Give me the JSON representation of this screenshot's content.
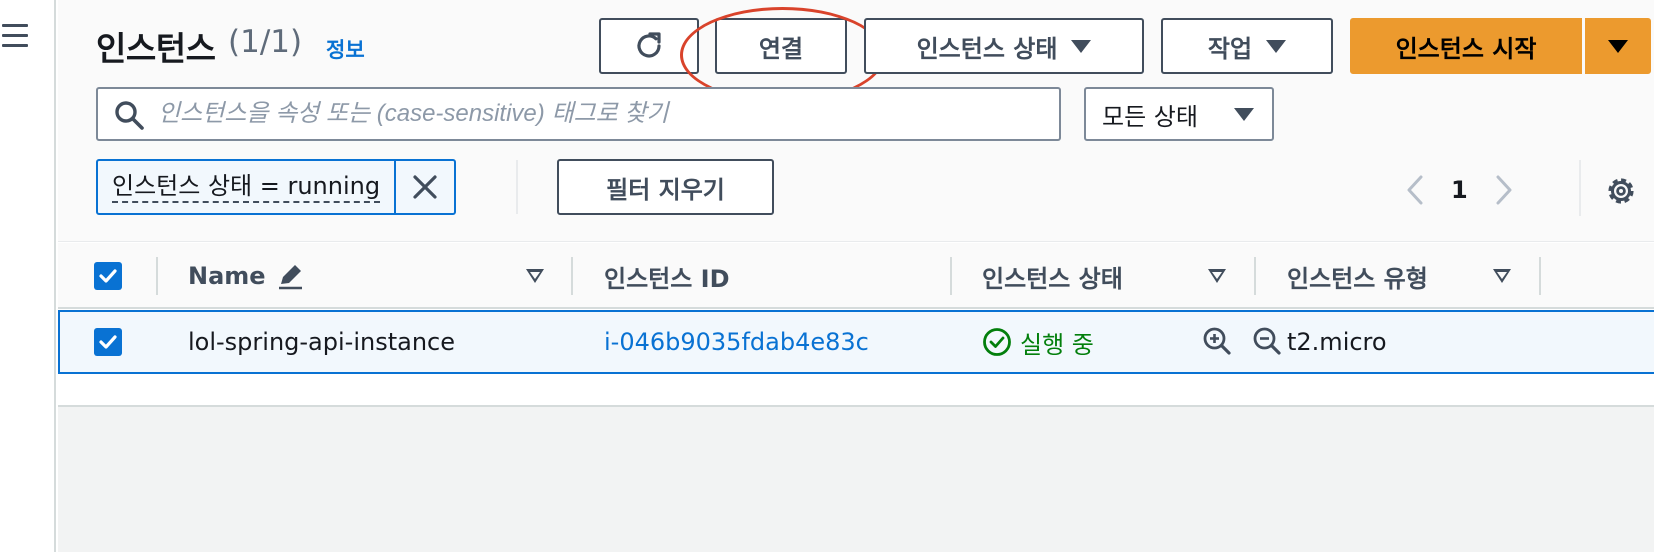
{
  "left_rail": {
    "menu_icon": "hamburger-menu-icon"
  },
  "header": {
    "title": "인스턴스",
    "count": "(1/1)",
    "info_link": "정보"
  },
  "toolbar": {
    "refresh_icon": "refresh-icon",
    "connect_label": "연결",
    "instance_state_label": "인스턴스 상태",
    "actions_label": "작업",
    "launch_label": "인스턴스 시작"
  },
  "annotation": {
    "color": "#d9432b"
  },
  "search": {
    "placeholder": "인스턴스을 속성 또는 (case-sensitive) 태그로 찾기",
    "value": ""
  },
  "state_filter": {
    "selected": "모든 상태"
  },
  "filter_token": {
    "label": "인스턴스 상태 = running"
  },
  "clear_filters_label": "필터 지우기",
  "pagination": {
    "current_page": "1"
  },
  "table": {
    "columns": [
      {
        "label": "Name"
      },
      {
        "label": "인스턴스 ID"
      },
      {
        "label": "인스턴스 상태"
      },
      {
        "label": "인스턴스 유형"
      }
    ],
    "rows": [
      {
        "selected": true,
        "name": "lol-spring-api-instance",
        "instance_id": "i-046b9035fdab4e83c",
        "state": "실행 중",
        "type": "t2.micro"
      }
    ]
  },
  "colors": {
    "primary_button": "#ec9a2e",
    "link": "#0972d3",
    "success": "#037f0c"
  }
}
